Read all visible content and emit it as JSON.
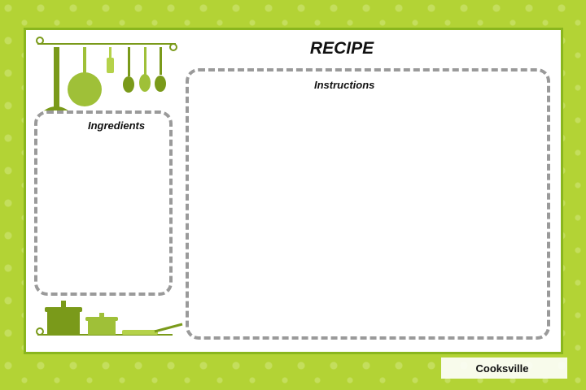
{
  "card": {
    "title": "RECIPE",
    "ingredients_label": "Ingredients",
    "instructions_label": "Instructions",
    "footer_name": "Cooksville"
  },
  "colors": {
    "border_green": "#b3d335",
    "dark_green": "#7a9a1a",
    "mid_green": "#9fc038",
    "light_green": "#b5d24a",
    "panel_outline": "#9a9a9a"
  },
  "icons": [
    "utensil-rack-icon",
    "ladle-icon",
    "pan-icon",
    "spatula-icon",
    "cookware-pots-icon",
    "frying-pan-icon"
  ]
}
